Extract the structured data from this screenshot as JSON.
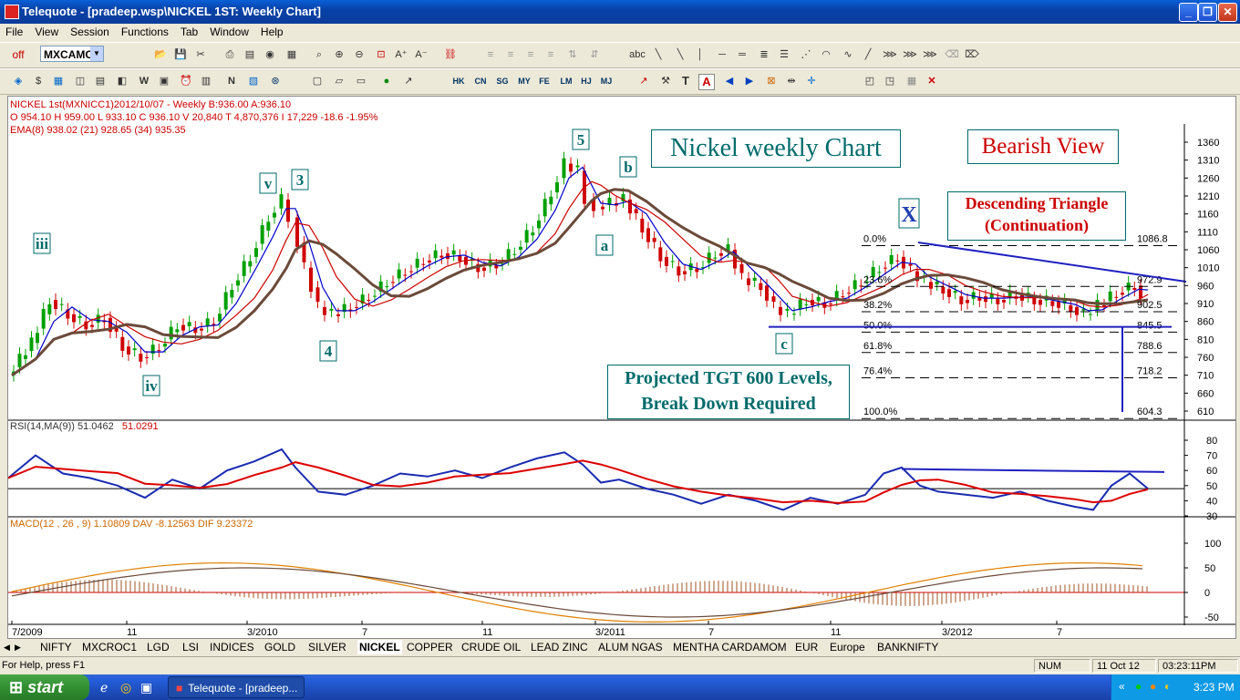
{
  "window": {
    "title": "Telequote - [pradeep.wsp\\NICKEL 1ST: Weekly Chart]"
  },
  "menu": [
    "File",
    "View",
    "Session",
    "Functions",
    "Tab",
    "Window",
    "Help"
  ],
  "toolbar": {
    "off_label": "off",
    "symbol": "MXCAMC",
    "exch_labels": [
      "HK",
      "CN",
      "SG",
      "MY",
      "FE",
      "LM",
      "HJ",
      "MJ"
    ],
    "abc_label": "abc",
    "text_tool": "T",
    "text_tool_red": "A"
  },
  "chart": {
    "info1": "NICKEL 1st(MXNICC1)2012/10/07  - Weekly B:936.00 A:936.10",
    "info2": "O 954.10 H 959.00 L 933.10 C 936.10 V 20,840 T 4,870,376 I 17,229 -18.6 -1.95%",
    "info3": "EMA(8) 938.02  (21) 928.65  (34) 935.35",
    "title_box": "Nickel weekly Chart",
    "view_box": "Bearish View",
    "triangle_box": [
      "Descending Triangle",
      "(Continuation)"
    ],
    "target_box": [
      "Projected TGT 600 Levels,",
      "Break Down Required"
    ],
    "waves": [
      "iii",
      "iv",
      "v",
      "3",
      "4",
      "5",
      "a",
      "b",
      "c",
      "X"
    ],
    "fib": [
      {
        "pct": "0.0%",
        "val": "1086.8"
      },
      {
        "pct": "23.6%",
        "val": "972.9"
      },
      {
        "pct": "38.2%",
        "val": "902.5"
      },
      {
        "pct": "50.0%",
        "val": "845.5"
      },
      {
        "pct": "61.8%",
        "val": "788.6"
      },
      {
        "pct": "76.4%",
        "val": "718.2"
      },
      {
        "pct": "100.0%",
        "val": "604.3"
      }
    ],
    "price_axis": [
      "1360",
      "1310",
      "1260",
      "1210",
      "1160",
      "1110",
      "1060",
      "1010",
      "960",
      "910",
      "860",
      "810",
      "760",
      "710",
      "660",
      "610"
    ],
    "rsi_label": "RSI(14,MA(9))  51.0462",
    "rsi_ma": "51.0291",
    "rsi_axis": [
      "80",
      "70",
      "60",
      "50",
      "40",
      "30"
    ],
    "macd_label": "MACD(12 , 26 , 9)  1.10809  DAV  -8.12563  DIF  9.23372",
    "macd_axis": [
      "100",
      "50",
      "0",
      "-50"
    ],
    "dates": [
      "7/2009",
      "11",
      "3/2010",
      "7",
      "11",
      "3/2011",
      "7",
      "11",
      "3/2012",
      "7"
    ]
  },
  "tabs": [
    "NIFTY",
    "MXCROC1",
    "LGD",
    "LSI",
    "INDICES",
    "GOLD",
    "SILVER",
    "NICKEL",
    "COPPER",
    "CRUDE OIL",
    "LEAD ZINC",
    "ALUM NGAS",
    "MENTHA CARDAMOM",
    "EUR",
    "Europe",
    "BANKNIFTY"
  ],
  "status": {
    "help": "For Help, press F1",
    "num": "NUM",
    "date": "11 Oct 12",
    "time": "03:23:11PM"
  },
  "taskbar": {
    "start": "start",
    "task": "Telequote - [pradeep...",
    "clock": "3:23 PM"
  },
  "colors": {
    "price_up": "#00a000",
    "price_down": "#d00000",
    "ema8": "#0000cc",
    "ema21": "#cc0000",
    "ema34": "#6b4a3a",
    "trendline": "#2020c0",
    "annot_blue": "#006b6b",
    "annot_red": "#cc0000"
  }
}
